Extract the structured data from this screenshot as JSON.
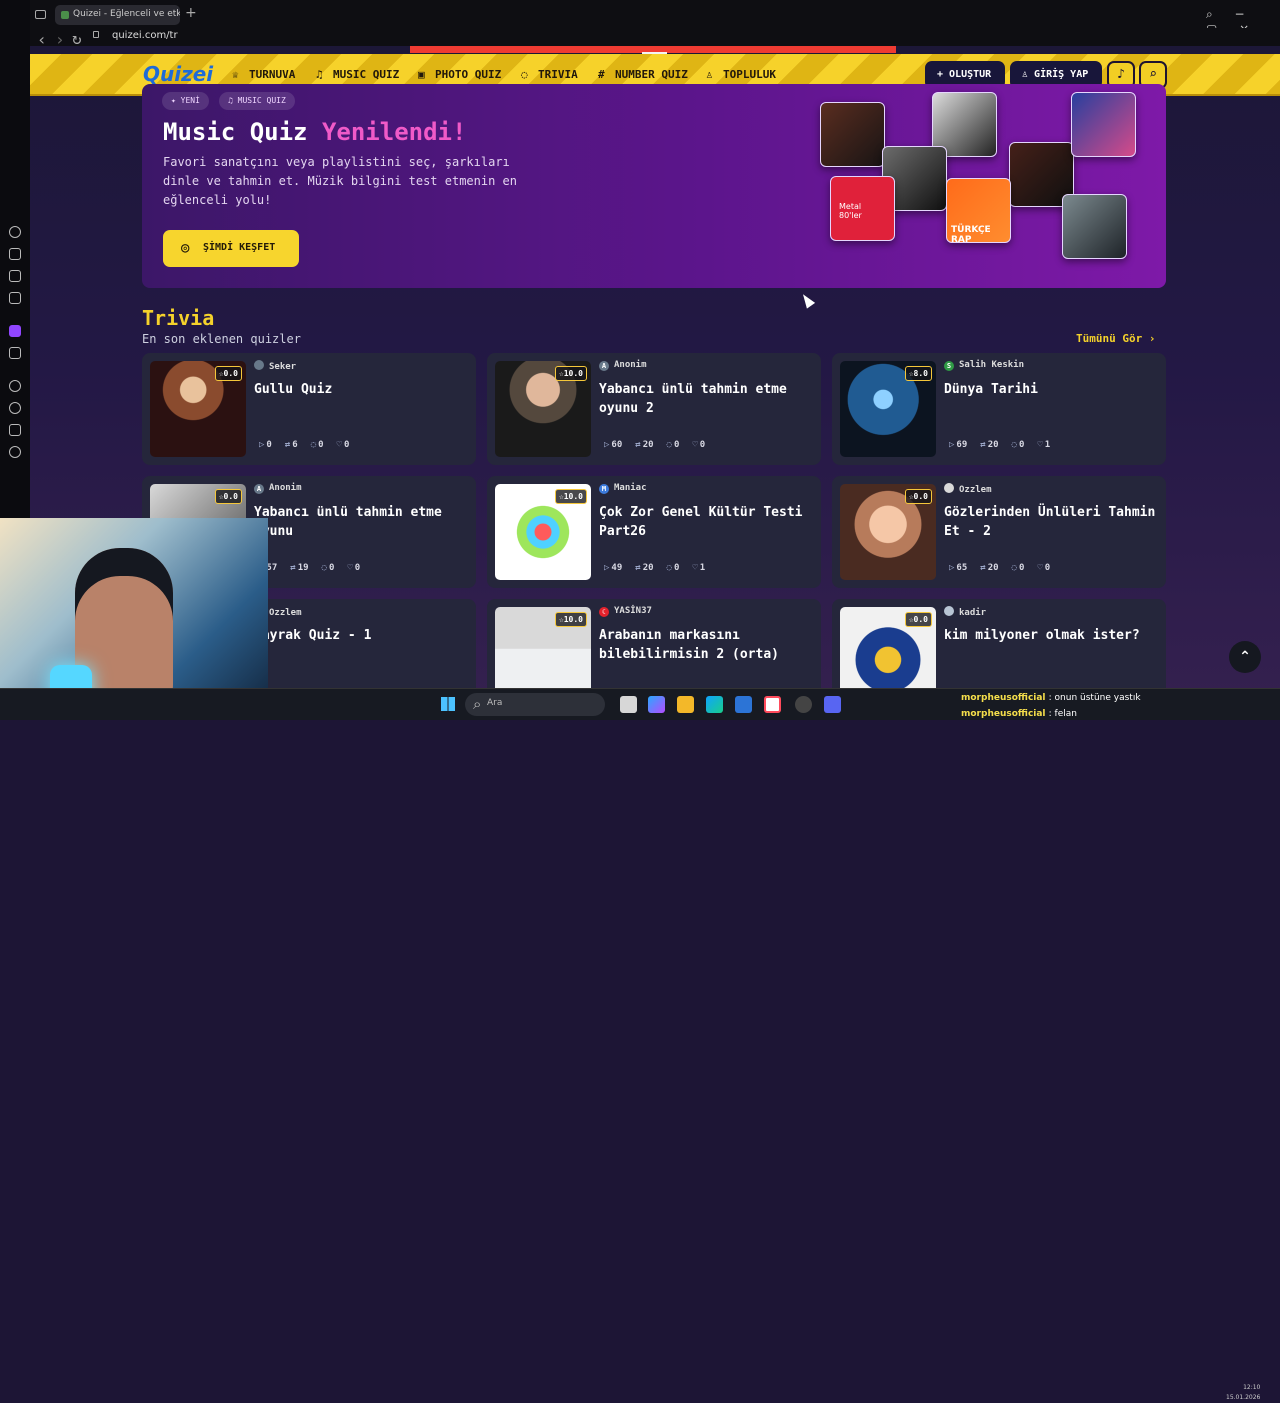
{
  "browser": {
    "tab_title": "Quizei - Eğlenceli ve etkile",
    "url": "quizei.com/tr"
  },
  "site": {
    "logo": "Quizei",
    "nav": [
      {
        "label": "TURNUVA",
        "icon": "trophy-icon"
      },
      {
        "label": "MUSIC QUIZ",
        "icon": "music-icon"
      },
      {
        "label": "PHOTO QUIZ",
        "icon": "camera-icon"
      },
      {
        "label": "TRIVIA",
        "icon": "chat-icon"
      },
      {
        "label": "NUMBER QUIZ",
        "icon": "hash-icon"
      },
      {
        "label": "TOPLULUK",
        "icon": "users-icon"
      }
    ],
    "create_label": "OLUŞTUR",
    "login_label": "GİRİŞ YAP"
  },
  "hero": {
    "chips": [
      "✦ YENİ",
      "♫ MUSIC QUIZ"
    ],
    "title_start": "Music Quiz",
    "title_highlight": "Yenilendi!",
    "description": "Favori sanatçını veya playlistini seç, şarkıları dinle ve tahmin et. Müzik bilgini test etmenin en eğlenceli yolu!",
    "button_label": "ŞİMDİ KEŞFET",
    "cover_labels": [
      "Metal 80'ler",
      "TÜRKÇE RAP"
    ]
  },
  "trivia": {
    "title": "Trivia",
    "subtitle": "En son eklenen quizler",
    "see_all": "Tümünü Gör ›",
    "cards": [
      {
        "rating": "0.0",
        "author": "Seker",
        "title": "Gullu Quiz",
        "plays": "0",
        "questions": "6",
        "comments": "0",
        "likes": "0"
      },
      {
        "rating": "10.0",
        "author": "Anonim",
        "title": "Yabancı ünlü tahmin etme oyunu 2",
        "plays": "60",
        "questions": "20",
        "comments": "0",
        "likes": "0"
      },
      {
        "rating": "8.0",
        "author": "Salih Keskin",
        "title": "Dünya Tarihi",
        "plays": "69",
        "questions": "20",
        "comments": "0",
        "likes": "1"
      },
      {
        "rating": "0.0",
        "author": "Anonim",
        "title": "Yabancı ünlü tahmin etme oyunu",
        "plays": "57",
        "questions": "19",
        "comments": "0",
        "likes": "0"
      },
      {
        "rating": "10.0",
        "author": "Maniac",
        "title": "Çok Zor Genel Kültür Testi Part26",
        "plays": "49",
        "questions": "20",
        "comments": "0",
        "likes": "1"
      },
      {
        "rating": "0.0",
        "author": "Ozzlem",
        "title": "Gözlerinden Ünlüleri Tahmin Et - 2",
        "plays": "65",
        "questions": "20",
        "comments": "0",
        "likes": "0"
      },
      {
        "rating": "",
        "author": "Ozzlem",
        "title": "Bayrak Quiz - 1",
        "plays": "",
        "questions": "",
        "comments": "",
        "likes": ""
      },
      {
        "rating": "10.0",
        "author": "YASİN37",
        "title": "Arabanın markasını bilebilirmisin 2 (orta)",
        "plays": "",
        "questions": "",
        "comments": "",
        "likes": ""
      },
      {
        "rating": "0.0",
        "author": "kadir",
        "title": "kim milyoner olmak ister?",
        "plays": "",
        "questions": "",
        "comments": "",
        "likes": ""
      }
    ]
  },
  "taskbar": {
    "search_placeholder": "Ara",
    "time": "12:10",
    "date": "15.01.2026"
  },
  "chat": [
    {
      "user": "morpheusofficial",
      "message": ": onun üstüne yastık"
    },
    {
      "user": "morpheusofficial",
      "message": ": felan"
    }
  ],
  "colors": {
    "header_yellow": "#f6d22a",
    "hero_purple": "#5c158c",
    "accent_pink": "#f05ac8",
    "card": "#25263b"
  }
}
